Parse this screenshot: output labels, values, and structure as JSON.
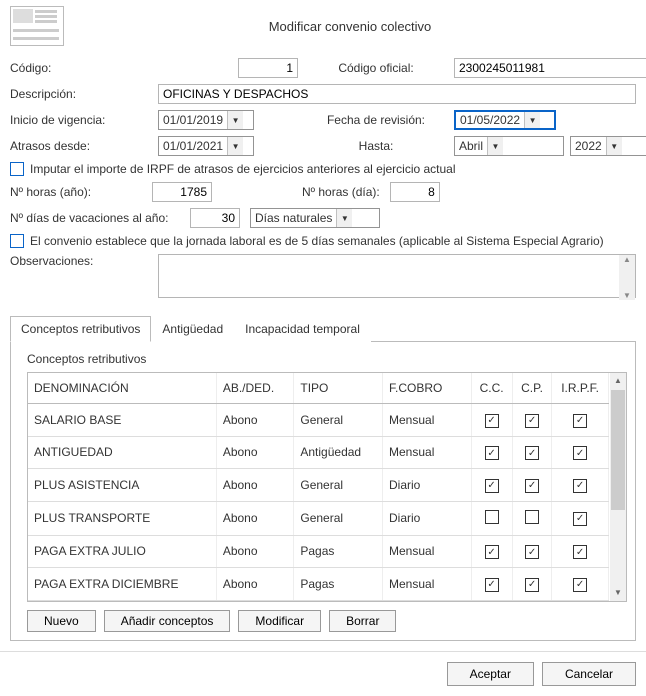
{
  "title": "Modificar convenio colectivo",
  "labels": {
    "codigo": "Código:",
    "codigo_oficial": "Código oficial:",
    "descripcion": "Descripción:",
    "inicio_vigencia": "Inicio de vigencia:",
    "fecha_revision": "Fecha de revisión:",
    "atrasos_desde": "Atrasos desde:",
    "hasta": "Hasta:",
    "imputar": "Imputar el importe de IRPF de atrasos de ejercicios anteriores al ejercicio actual",
    "horas_ano": "Nº horas (año):",
    "horas_dia": "Nº horas (día):",
    "dias_vacaciones": "Nº días de vacaciones al año:",
    "jornada5": "El convenio establece que la jornada laboral es de 5 días semanales (aplicable al Sistema Especial Agrario)",
    "observaciones": "Observaciones:"
  },
  "values": {
    "codigo": "1",
    "codigo_oficial": "2300245011981",
    "descripcion": "OFICINAS Y DESPACHOS",
    "inicio_vigencia": "01/01/2019",
    "fecha_revision": "01/05/2022",
    "atrasos_desde": "01/01/2021",
    "hasta_mes": "Abril",
    "hasta_ano": "2022",
    "horas_ano": "1785",
    "horas_dia": "8",
    "dias_vacaciones": "30",
    "dias_vacaciones_tipo": "Días naturales"
  },
  "tabs": {
    "t1": "Conceptos retributivos",
    "t2": "Antigüedad",
    "t3": "Incapacidad temporal"
  },
  "table": {
    "title": "Conceptos retributivos",
    "headers": {
      "den": "DENOMINACIÓN",
      "abded": "AB./DED.",
      "tipo": "TIPO",
      "fcobro": "F.COBRO",
      "cc": "C.C.",
      "cp": "C.P.",
      "irpf": "I.R.P.F."
    },
    "rows": [
      {
        "den": "SALARIO BASE",
        "abded": "Abono",
        "tipo": "General",
        "fcobro": "Mensual",
        "cc": true,
        "cp": true,
        "irpf": true
      },
      {
        "den": "ANTIGUEDAD",
        "abded": "Abono",
        "tipo": "Antigüedad",
        "fcobro": "Mensual",
        "cc": true,
        "cp": true,
        "irpf": true
      },
      {
        "den": "PLUS ASISTENCIA",
        "abded": "Abono",
        "tipo": "General",
        "fcobro": "Diario",
        "cc": true,
        "cp": true,
        "irpf": true
      },
      {
        "den": "PLUS TRANSPORTE",
        "abded": "Abono",
        "tipo": "General",
        "fcobro": "Diario",
        "cc": false,
        "cp": false,
        "irpf": true
      },
      {
        "den": "PAGA EXTRA JULIO",
        "abded": "Abono",
        "tipo": "Pagas",
        "fcobro": "Mensual",
        "cc": true,
        "cp": true,
        "irpf": true
      },
      {
        "den": "PAGA EXTRA DICIEMBRE",
        "abded": "Abono",
        "tipo": "Pagas",
        "fcobro": "Mensual",
        "cc": true,
        "cp": true,
        "irpf": true
      }
    ]
  },
  "buttons": {
    "nuevo": "Nuevo",
    "anadir": "Añadir conceptos",
    "modificar": "Modificar",
    "borrar": "Borrar",
    "aceptar": "Aceptar",
    "cancelar": "Cancelar"
  }
}
